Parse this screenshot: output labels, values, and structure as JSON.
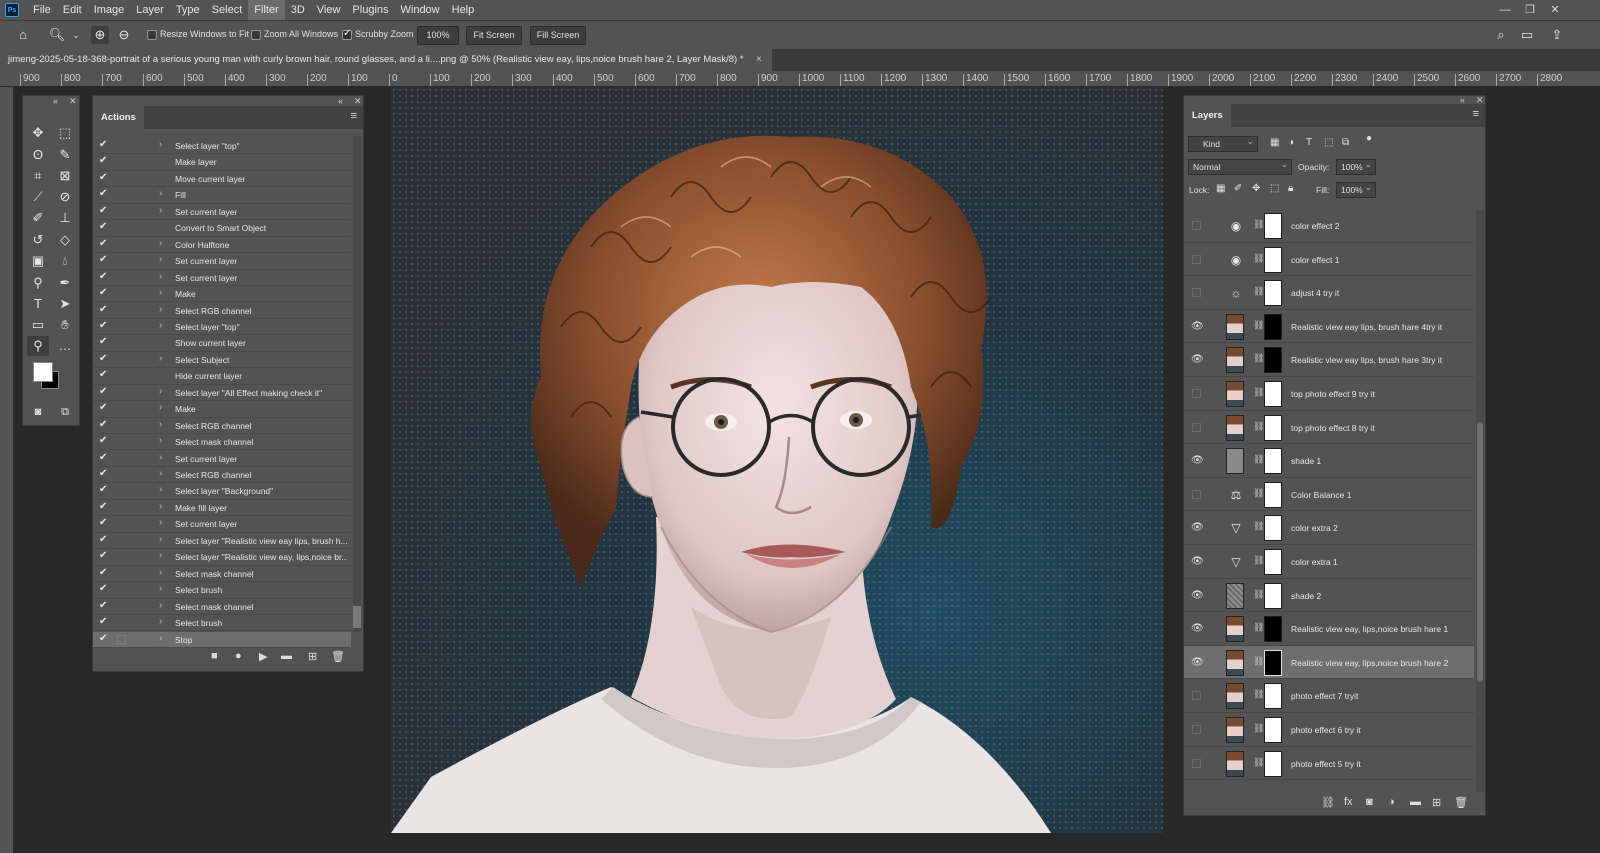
{
  "menubar": {
    "logo": "Ps",
    "items": [
      "File",
      "Edit",
      "Image",
      "Layer",
      "Type",
      "Select",
      "Filter",
      "3D",
      "View",
      "Plugins",
      "Window",
      "Help"
    ],
    "active": "Filter"
  },
  "optionsbar": {
    "resize_windows": "Resize Windows to Fit",
    "zoom_all": "Zoom All Windows",
    "scrubby_zoom": "Scrubby Zoom",
    "zoom_value": "100%",
    "fit_screen": "Fit Screen",
    "fill_screen": "Fill Screen"
  },
  "document": {
    "tab_title": "jimeng-2025-05-18-368-portrait of a serious young man with curly brown hair, round glasses, and a li....png @ 50% (Realistic view eay, lips,noice brush hare 2, Layer Mask/8) *",
    "close": "×"
  },
  "ruler": {
    "ticks": [
      "900",
      "800",
      "700",
      "600",
      "500",
      "400",
      "300",
      "200",
      "100",
      "0",
      "100",
      "200",
      "300",
      "400",
      "500",
      "600",
      "700",
      "800",
      "900",
      "1000",
      "1100",
      "1200",
      "1300",
      "1400",
      "1500",
      "1600",
      "1700",
      "1800",
      "1900",
      "2000",
      "2100",
      "2200",
      "2300",
      "2400",
      "2500",
      "2600",
      "2700",
      "2800"
    ]
  },
  "actions_panel": {
    "title": "Actions",
    "rows": [
      {
        "label": "Select layer \"top\"",
        "expand": true
      },
      {
        "label": "Make layer",
        "expand": false
      },
      {
        "label": "Move current layer",
        "expand": false
      },
      {
        "label": "Fill",
        "expand": true
      },
      {
        "label": "Set current layer",
        "expand": true
      },
      {
        "label": "Convert to Smart Object",
        "expand": false
      },
      {
        "label": "Color Halftone",
        "expand": true
      },
      {
        "label": "Set current layer",
        "expand": true
      },
      {
        "label": "Set current layer",
        "expand": true
      },
      {
        "label": "Make",
        "expand": true
      },
      {
        "label": "Select RGB channel",
        "expand": true
      },
      {
        "label": "Select layer \"top\"",
        "expand": true
      },
      {
        "label": "Show current layer",
        "expand": false
      },
      {
        "label": "Select Subject",
        "expand": true
      },
      {
        "label": "Hide current layer",
        "expand": false
      },
      {
        "label": "Select layer \"All Effect making check it\"",
        "expand": true
      },
      {
        "label": "Make",
        "expand": true
      },
      {
        "label": "Select RGB channel",
        "expand": true
      },
      {
        "label": "Select mask channel",
        "expand": true
      },
      {
        "label": "Set current layer",
        "expand": true
      },
      {
        "label": "Select RGB channel",
        "expand": true
      },
      {
        "label": "Select layer \"Background\"",
        "expand": true
      },
      {
        "label": "Make fill layer",
        "expand": true
      },
      {
        "label": "Set current layer",
        "expand": true
      },
      {
        "label": "Select layer \"Realistic view eay lips, brush h...",
        "expand": true
      },
      {
        "label": "Select layer \"Realistic view eay, lips,noice br...",
        "expand": true
      },
      {
        "label": "Select mask channel",
        "expand": true
      },
      {
        "label": "Select brush",
        "expand": true
      },
      {
        "label": "Select mask channel",
        "expand": true
      },
      {
        "label": "Select brush",
        "expand": true
      },
      {
        "label": "Stop",
        "expand": true,
        "selected": true
      }
    ]
  },
  "layers_panel": {
    "title": "Layers",
    "filter_kind": "Kind",
    "blend_mode": "Normal",
    "opacity_label": "Opacity:",
    "opacity_value": "100%",
    "lock_label": "Lock:",
    "fill_label": "Fill:",
    "fill_value": "100%",
    "layers": [
      {
        "name": "color effect 2",
        "visible": false,
        "thumb": "adjust-camera",
        "mask": "white"
      },
      {
        "name": "color effect 1",
        "visible": false,
        "thumb": "adjust-camera",
        "mask": "white"
      },
      {
        "name": "adjust 4 try it",
        "visible": false,
        "thumb": "adjust-sun",
        "mask": "white"
      },
      {
        "name": "Realistic view eay lips, brush hare 4try it",
        "visible": true,
        "thumb": "photo",
        "mask": "black"
      },
      {
        "name": "Realistic view eay lips, brush hare 3try it",
        "visible": true,
        "thumb": "photo",
        "mask": "black"
      },
      {
        "name": "top photo effect 9 try it",
        "visible": false,
        "thumb": "photo",
        "mask": "white"
      },
      {
        "name": "top photo effect 8 try it",
        "visible": false,
        "thumb": "photo",
        "mask": "white"
      },
      {
        "name": "shade 1",
        "visible": true,
        "thumb": "gray",
        "mask": "white"
      },
      {
        "name": "Color Balance 1",
        "visible": false,
        "thumb": "adjust-balance",
        "mask": "white"
      },
      {
        "name": "color extra 2",
        "visible": true,
        "thumb": "adjust-triangle",
        "mask": "white"
      },
      {
        "name": "color extra 1",
        "visible": true,
        "thumb": "adjust-triangle",
        "mask": "white"
      },
      {
        "name": "shade 2",
        "visible": true,
        "thumb": "noise",
        "mask": "white"
      },
      {
        "name": "Realistic view eay, lips,noice brush hare 1",
        "visible": true,
        "thumb": "photo",
        "mask": "black"
      },
      {
        "name": "Realistic view eay, lips,noice brush hare 2",
        "visible": true,
        "thumb": "photo",
        "mask": "black",
        "selected": true
      },
      {
        "name": "photo effect 7 tryit",
        "visible": false,
        "thumb": "photo",
        "mask": "white"
      },
      {
        "name": "photo effect 6 try it",
        "visible": false,
        "thumb": "photo",
        "mask": "white"
      },
      {
        "name": "photo effect 5 try it",
        "visible": false,
        "thumb": "photo",
        "mask": "white"
      }
    ]
  },
  "colors": {
    "ui_panel": "#535353",
    "ui_dark": "#282828",
    "selection": "#6e6e6e",
    "accent": "#31a8ff"
  }
}
